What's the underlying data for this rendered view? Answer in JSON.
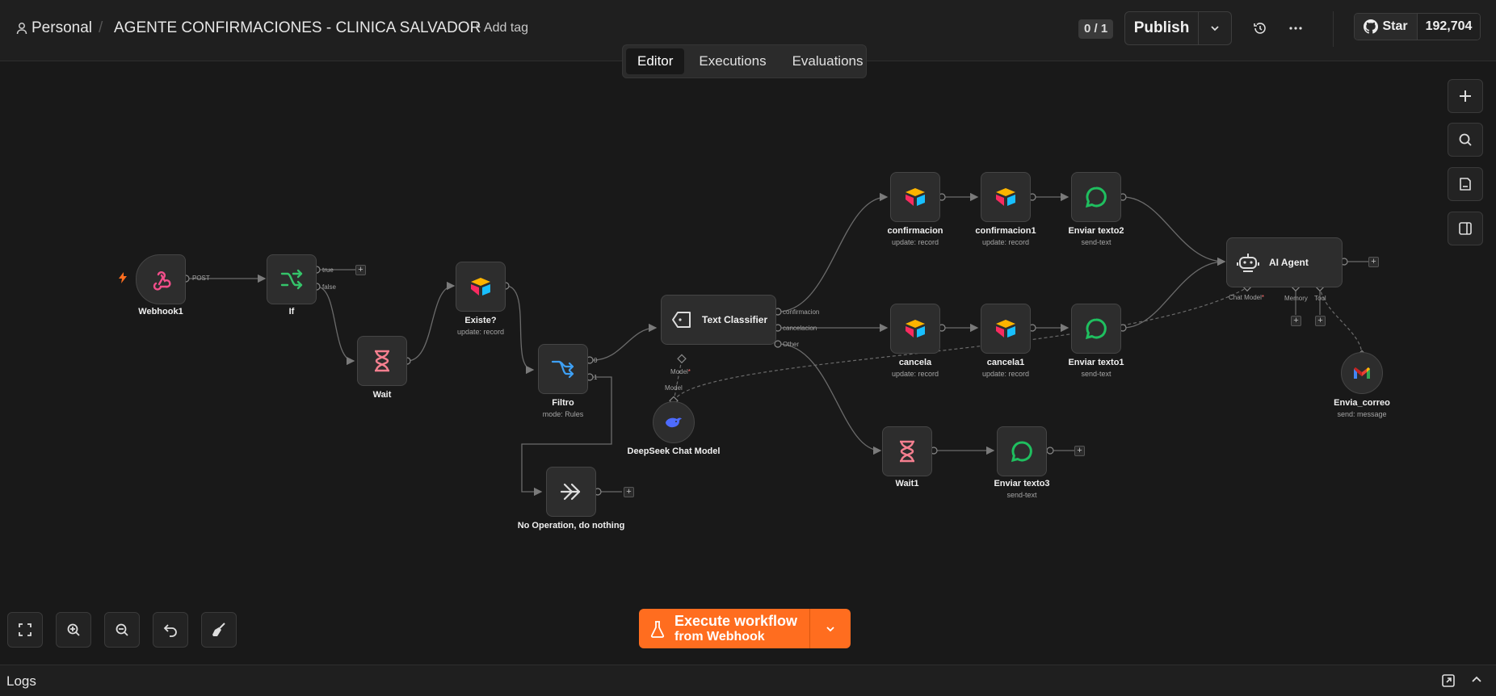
{
  "header": {
    "project": "Personal",
    "workflow_name": "AGENTE CONFIRMACIONES - CLINICA SALVADOR",
    "add_tag": "+ Add tag",
    "counter": "0 / 1",
    "publish_label": "Publish",
    "github_star": "Star",
    "github_count": "192,704"
  },
  "tabs": [
    "Editor",
    "Executions",
    "Evaluations"
  ],
  "nodes": {
    "webhook1": {
      "name": "Webhook1",
      "edge": "POST"
    },
    "if": {
      "name": "If",
      "true": "true",
      "false": "false"
    },
    "wait": {
      "name": "Wait"
    },
    "existe": {
      "name": "Existe?",
      "sub": "update: record"
    },
    "filtro": {
      "name": "Filtro",
      "sub": "mode: Rules",
      "out0": "0",
      "out1": "1"
    },
    "noop": {
      "name": "No Operation, do nothing"
    },
    "text_classifier": {
      "name": "Text Classifier",
      "out_confirmacion": "confirmacion",
      "out_cancelacion": "cancelacion",
      "out_other": "Other",
      "model_label": "Model",
      "model_label2": "Model"
    },
    "deepseek": {
      "name": "DeepSeek Chat Model"
    },
    "confirmacion": {
      "name": "confirmacion",
      "sub": "update: record"
    },
    "confirmacion1": {
      "name": "confirmacion1",
      "sub": "update: record"
    },
    "enviar_texto2": {
      "name": "Enviar texto2",
      "sub": "send-text"
    },
    "cancela": {
      "name": "cancela",
      "sub": "update: record"
    },
    "cancela1": {
      "name": "cancela1",
      "sub": "update: record"
    },
    "enviar_texto1": {
      "name": "Enviar texto1",
      "sub": "send-text"
    },
    "wait1": {
      "name": "Wait1"
    },
    "enviar_texto3": {
      "name": "Enviar texto3",
      "sub": "send-text"
    },
    "ai_agent": {
      "name": "AI Agent",
      "chat_model": "Chat Model",
      "memory": "Memory",
      "tool": "Tool"
    },
    "envia_correo": {
      "name": "Envia_correo",
      "sub": "send: message"
    }
  },
  "execute": {
    "line1": "Execute workflow",
    "line2": "from Webhook"
  },
  "logs": {
    "title": "Logs"
  },
  "colors": {
    "accent": "#ff6d1f",
    "canvas": "#191919",
    "whatsapp": "#1fbf5f",
    "wait": "#f57f8f"
  }
}
